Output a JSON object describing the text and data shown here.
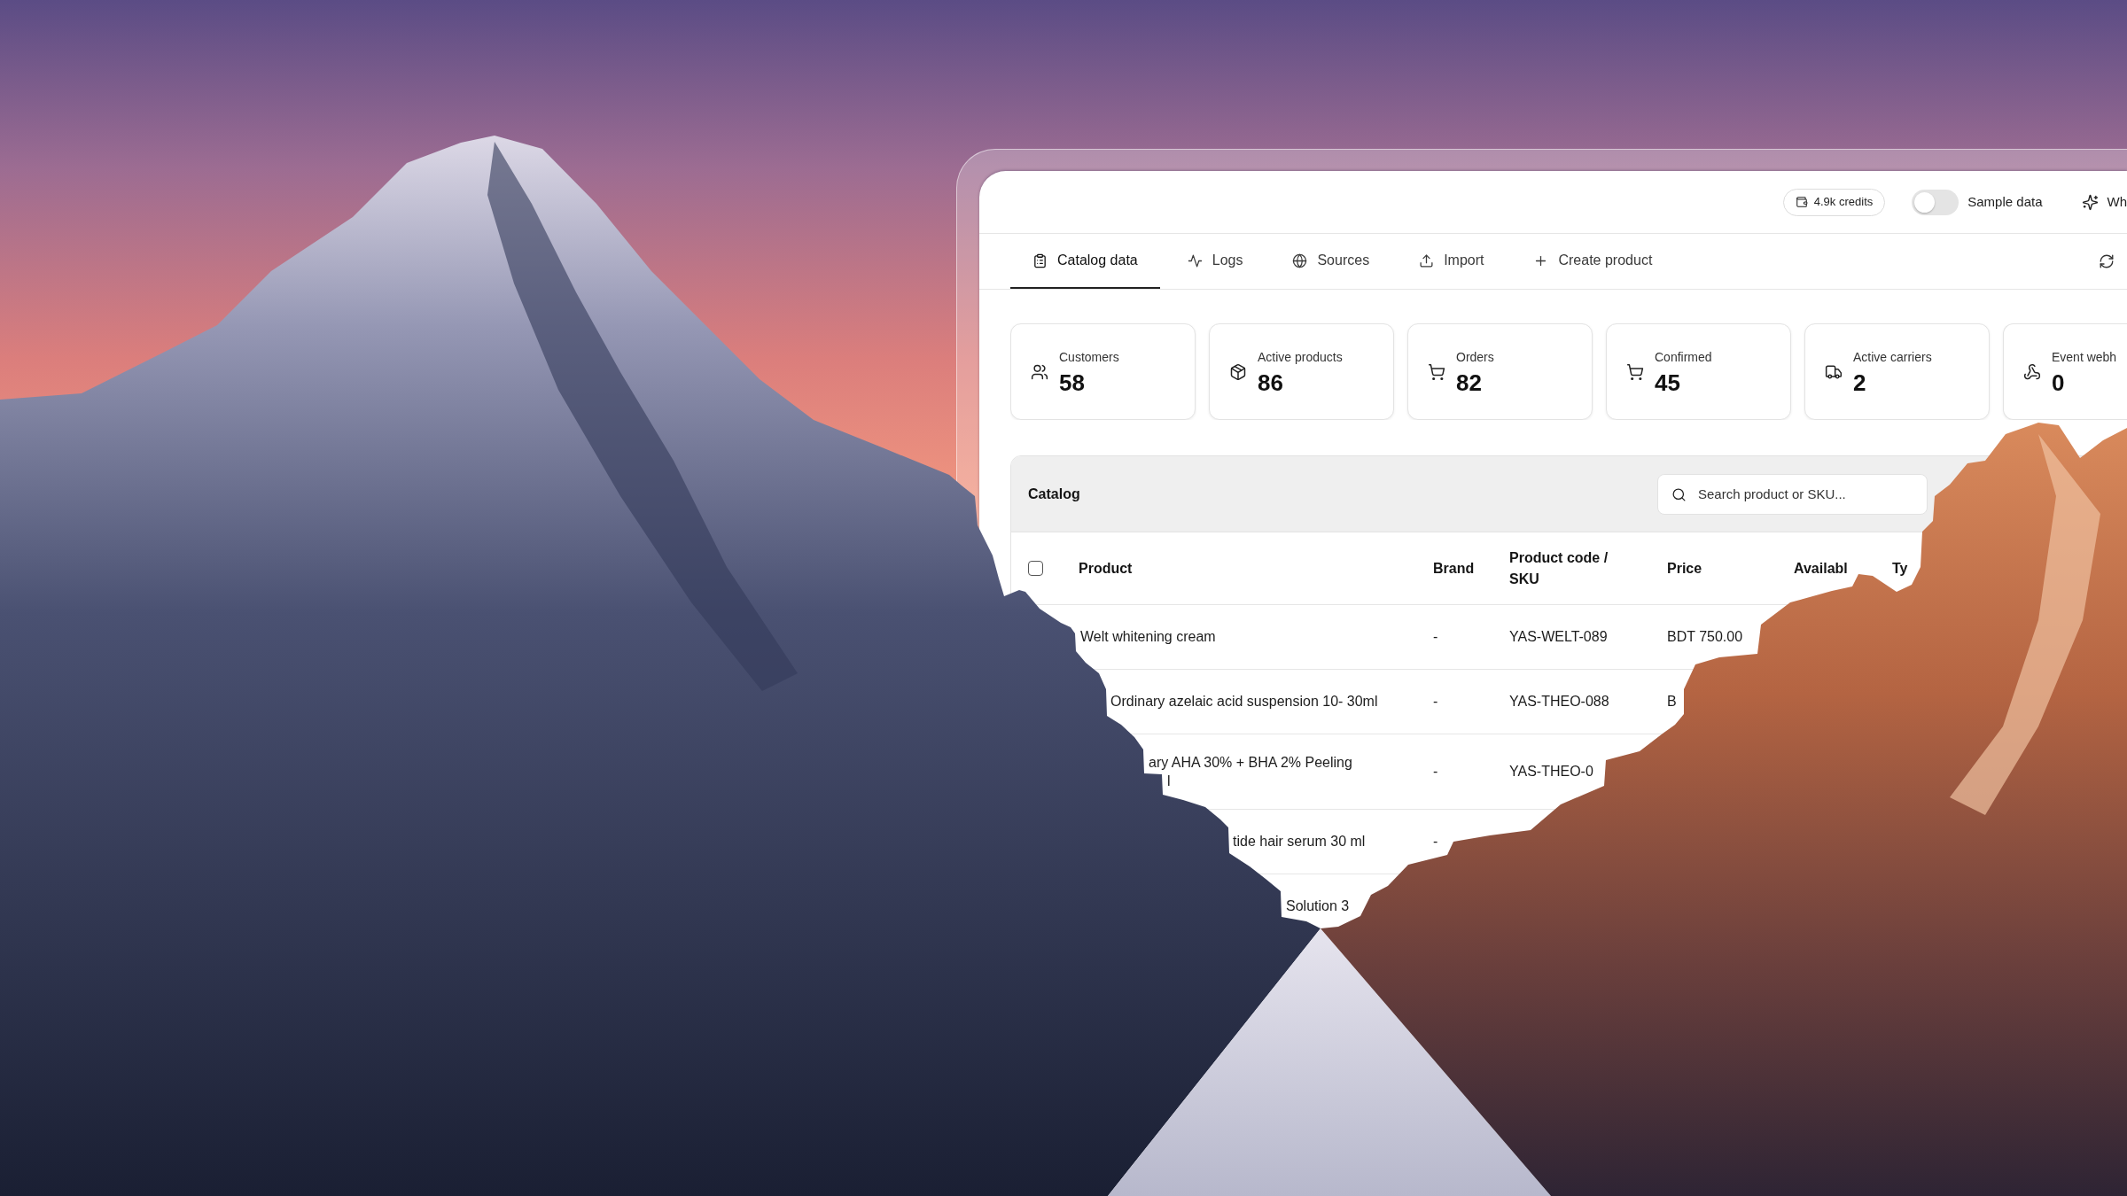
{
  "top_bar": {
    "credits": "4.9k credits",
    "sample_data": {
      "label": "Sample data",
      "on": false
    },
    "button": {
      "label": "Wh"
    }
  },
  "tabs": [
    {
      "label": "Catalog data",
      "selected": true
    },
    {
      "label": "Logs",
      "selected": false
    },
    {
      "label": "Sources",
      "selected": false
    },
    {
      "label": "Import",
      "selected": false
    },
    {
      "label": "Create product",
      "selected": false
    }
  ],
  "stats": [
    {
      "label": "Customers",
      "value": "58"
    },
    {
      "label": "Active products",
      "value": "86"
    },
    {
      "label": "Orders",
      "value": "82"
    },
    {
      "label": "Confirmed",
      "value": "45"
    },
    {
      "label": "Active carriers",
      "value": "2"
    },
    {
      "label": "Event webh",
      "value": "0"
    }
  ],
  "catalog": {
    "title": "Catalog",
    "search": {
      "placeholder": "Search product or SKU..."
    },
    "table": {
      "select_all": {
        "checked": false
      },
      "columns": [
        "Product",
        "Brand",
        "Product code / SKU",
        "Price",
        "Availabl",
        "Ty"
      ],
      "rows": [
        {
          "product": [
            "Welt whitening cream"
          ],
          "brand": "-",
          "sku": "YAS-WELT-089",
          "price": "BDT 750.00"
        },
        {
          "product": [
            "Ordinary azelaic acid suspension 10- 30ml"
          ],
          "brand": "-",
          "sku": "YAS-THEO-088",
          "price": "B"
        },
        {
          "product": [
            "ary AHA 30% + BHA 2% Peeling",
            "l"
          ],
          "brand": "-",
          "sku": "YAS-THEO-0"
        },
        {
          "product": [
            "tide hair serum 30 ml"
          ],
          "brand": "-"
        },
        {
          "product": [
            "Solution 3"
          ]
        }
      ]
    }
  }
}
